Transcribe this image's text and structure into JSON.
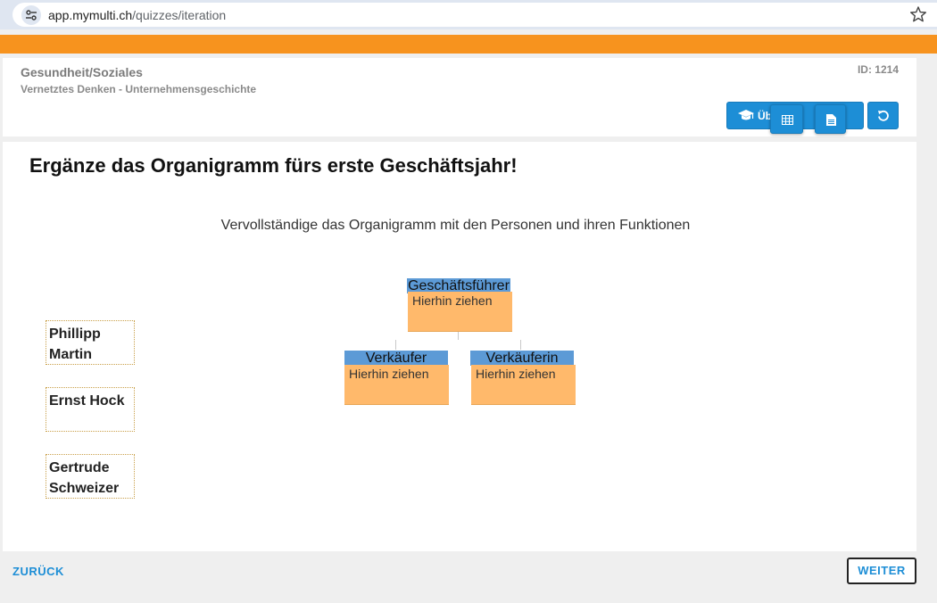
{
  "browser": {
    "url_domain": "app.mymulti.ch",
    "url_path": "/quizzes/iteration",
    "icons": {
      "site_settings": "tune-icon",
      "bookmark": "star-icon"
    }
  },
  "colors": {
    "accent": "#f7931e",
    "primary_blue": "#1d8ed6",
    "org_header": "#5c9ad6",
    "drop_zone": "#ffb96b",
    "background": "#efefef"
  },
  "header": {
    "category": "Gesundheit/Soziales",
    "subcategory": "Vernetztes Denken - Unternehmensgeschichte",
    "id_label": "ID: 1214",
    "buttons": {
      "uebungsmodus_partial_label": "Üb        Be        n",
      "uebungsmodus_icon": "graduation-cap-icon",
      "table_icon": "table-icon",
      "document_icon": "document-icon",
      "reset_icon": "reset-icon"
    }
  },
  "quiz": {
    "title": "Ergänze das Organigramm fürs erste Geschäftsjahr!",
    "instruction": "Vervollständige das Organigramm mit den Personen und ihren Funktionen",
    "draggable_items": [
      {
        "label": "Phillipp Martin"
      },
      {
        "label": "Ernst Hock"
      },
      {
        "label": "Gertrude Schweizer"
      }
    ],
    "org_chart": {
      "top": {
        "role": "Geschäftsführer",
        "placeholder": "Hierhin ziehen"
      },
      "left": {
        "role": "Verkäufer",
        "placeholder": "Hierhin ziehen"
      },
      "right": {
        "role": "Verkäuferin",
        "placeholder": "Hierhin ziehen"
      }
    }
  },
  "footer": {
    "back_label": "ZURÜCK",
    "next_label": "WEITER"
  }
}
